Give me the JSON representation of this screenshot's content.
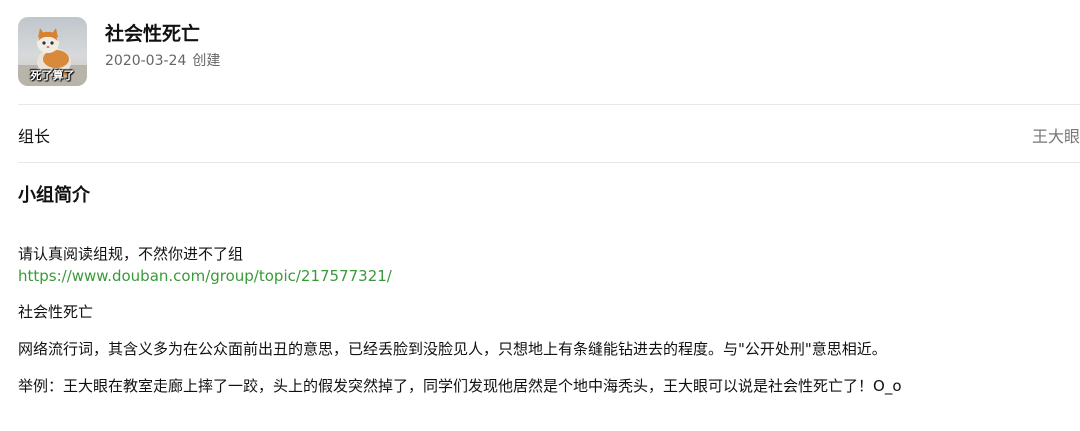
{
  "group": {
    "title": "社会性死亡",
    "created_date": "2020-03-24",
    "created_label": "创建",
    "avatar_caption": "死了算了",
    "avatar_icon": "cat-photo-icon"
  },
  "leader": {
    "label": "组长",
    "name": "王大眼"
  },
  "intro": {
    "heading": "小组简介",
    "rules_notice": "请认真阅读组规，不然你进不了组",
    "rules_link": "https://www.douban.com/group/topic/217577321/",
    "term": "社会性死亡",
    "definition": "网络流行词，其含义多为在公众面前出丑的意思，已经丢脸到没脸见人，只想地上有条缝能钻进去的程度。与\"公开处刑\"意思相近。",
    "example": "举例：王大眼在教室走廊上摔了一跤，头上的假发突然掉了，同学们发现他居然是个地中海秃头，王大眼可以说是社会性死亡了！O_o"
  },
  "colors": {
    "link": "#3a9a3a",
    "muted": "#666666",
    "divider": "#e8e8e8"
  }
}
